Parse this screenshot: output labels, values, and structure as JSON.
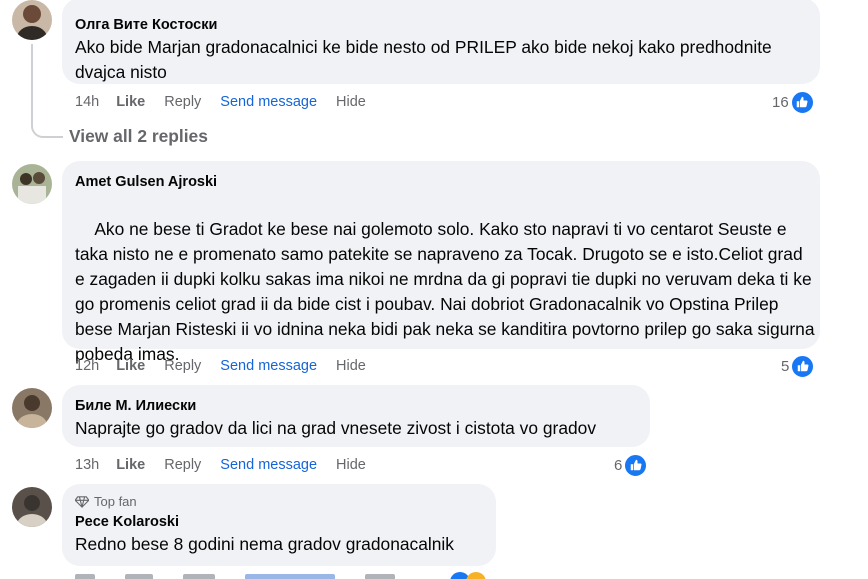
{
  "comments": [
    {
      "author": "Олга Вите Костоски",
      "text": "Ako bide Marjan gradonacalnici ke bide nesto od PRILEP ako bide nekoj kako predhodnite dvajca nisto",
      "time": "14h",
      "reaction_count": "16",
      "avatar_color": "#6b4a3a"
    },
    {
      "author": "Amet Gulsen Ajroski",
      "text": "Ako ne bese ti Gradot ke bese nai golemoto solo. Kako sto napravi ti vo centarot Seuste e taka nisto ne e promenato samo patekite se napraveno za Tocak. Drugoto se e isto.Celiot grad e zagaden ii dupki kolku sakas ima nikoi ne mrdna da gi popravi tie dupki no veruvam deka ti ke go promenis celiot grad ii da bide cist i poubav. Nai dobriot Gradonacalnik vo Opstina Prilep bese Marjan Risteski ii vo idnina neka bidi pak neka se kanditira povtorno prilep go saka sigurna pobeda imas.",
      "time": "12h",
      "reaction_count": "5",
      "avatar_color": "#7d8c6a"
    },
    {
      "author": "Биле М. Илиески",
      "text": "Naprajte go gradov da lici na grad vnesete zivost i cistota vo gradov",
      "time": "13h",
      "reaction_count": "6",
      "avatar_color": "#4a3a2e"
    },
    {
      "author": "Pece Kolaroski",
      "badge": "Top fan",
      "text": "Redno bese 8 godini nema gradov gradonacalnik",
      "avatar_color": "#3a3430"
    }
  ],
  "actions": {
    "like": "Like",
    "reply": "Reply",
    "send_message": "Send message",
    "hide": "Hide"
  },
  "view_replies": "View all 2 replies",
  "colors": {
    "bubble": "#f0f2f5",
    "link_blue": "#1565d8",
    "like_blue": "#1877f2",
    "heart_red": "#e41e3f",
    "meta_gray": "#65676b"
  }
}
